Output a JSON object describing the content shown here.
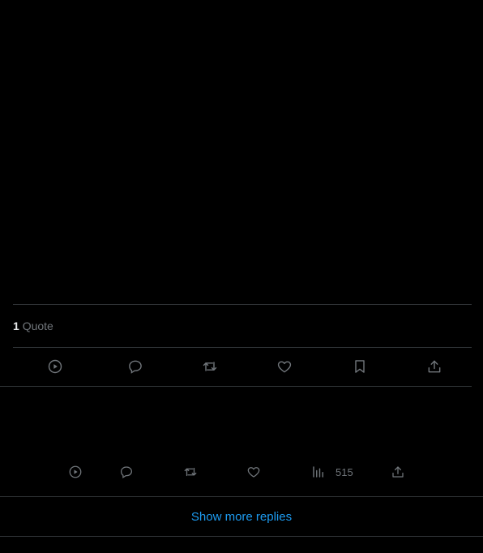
{
  "main_tweet": {
    "quote_count": "1",
    "quote_label": "Quote"
  },
  "action_icons": [
    "play-icon",
    "reply-icon",
    "retweet-icon",
    "like-icon",
    "bookmark-icon",
    "share-icon"
  ],
  "reply": {
    "views_count": "515",
    "action_icons": [
      "play-icon",
      "reply-icon",
      "retweet-icon",
      "like-icon",
      "views-icon",
      "share-icon"
    ]
  },
  "show_more": {
    "label": "Show more replies"
  },
  "colors": {
    "background": "#000000",
    "divider": "#2f3336",
    "icon": "#71767b",
    "link": "#1d9bf0",
    "text": "#e7e9ea"
  }
}
